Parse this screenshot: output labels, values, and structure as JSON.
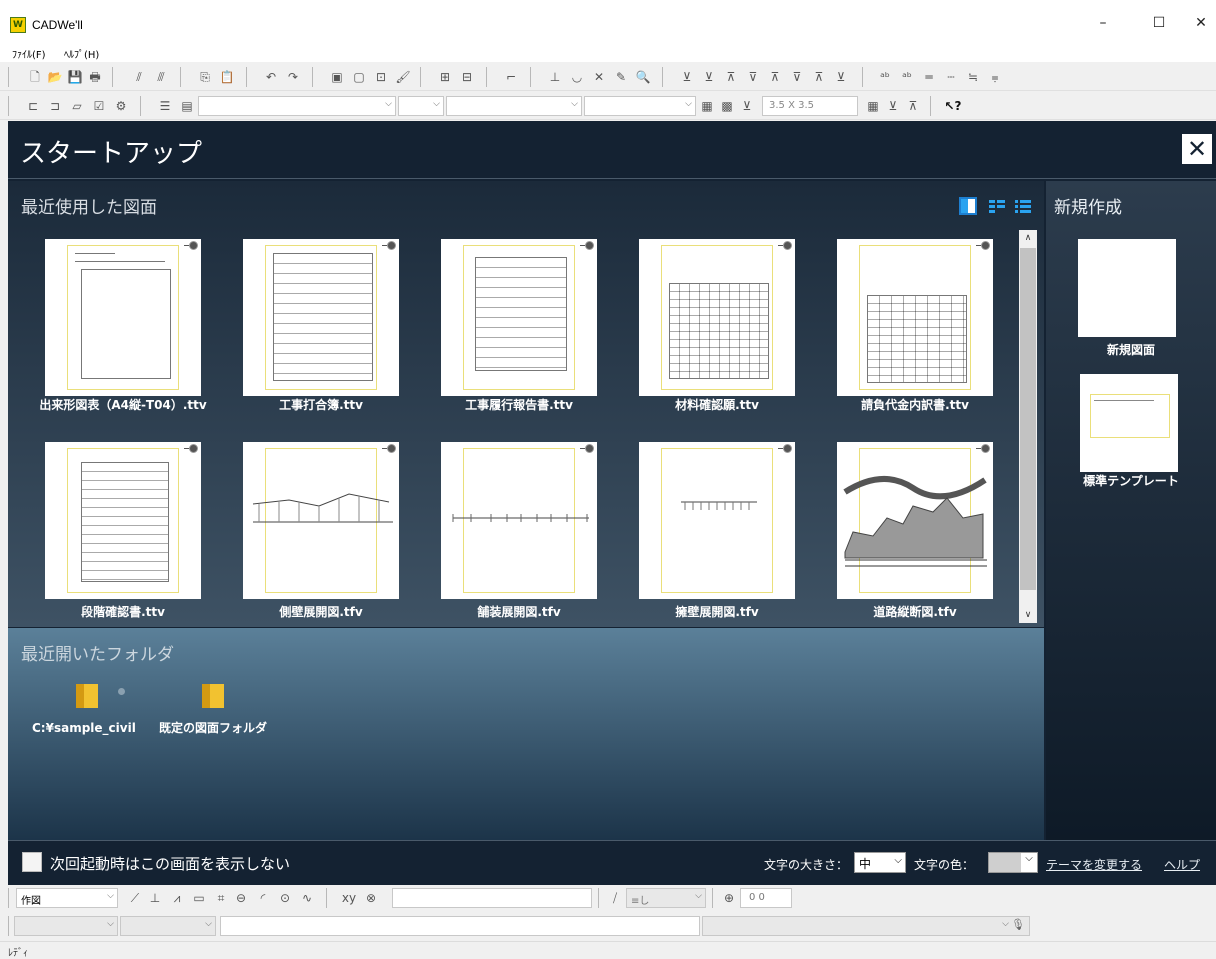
{
  "window": {
    "title": "CADWe'll",
    "minimize": "–",
    "maximize": "☐",
    "close": "✕"
  },
  "menu": [
    "ﾌｧｲﾙ(F)",
    "ﾍﾙﾌﾟ(H)"
  ],
  "toolbar": {
    "scale_value": "3.5 X 3.5"
  },
  "startup": {
    "title": "スタートアップ",
    "recent_heading": "最近使用した図面",
    "recent_files": [
      "出来形図表（A4縦-T04）.ttv",
      "工事打合簿.ttv",
      "工事履行報告書.ttv",
      "材料確認願.ttv",
      "請負代金内訳書.ttv",
      "段階確認書.ttv",
      "側壁展開図.tfv",
      "舗装展開図.tfv",
      "擁壁展開図.tfv",
      "道路縦断図.tfv"
    ],
    "folders_heading": "最近開いたフォルダ",
    "folders": [
      "C:¥sample_civil",
      "既定の図面フォルダ"
    ],
    "new_heading": "新規作成",
    "new_items": [
      "新規図面",
      "標準テンプレート"
    ],
    "footer": {
      "dont_show": "次回起動時はこの画面を表示しない",
      "font_size_label": "文字の大きさ：",
      "font_size_value": "中",
      "font_color_label": "文字の色：",
      "theme_link": "テーマを変更する",
      "help_link": "ヘルプ"
    }
  },
  "bottom": {
    "mode": "作図",
    "layer": "≡し",
    "coord": "0 0"
  },
  "status": "ﾚﾃﾞｨ"
}
